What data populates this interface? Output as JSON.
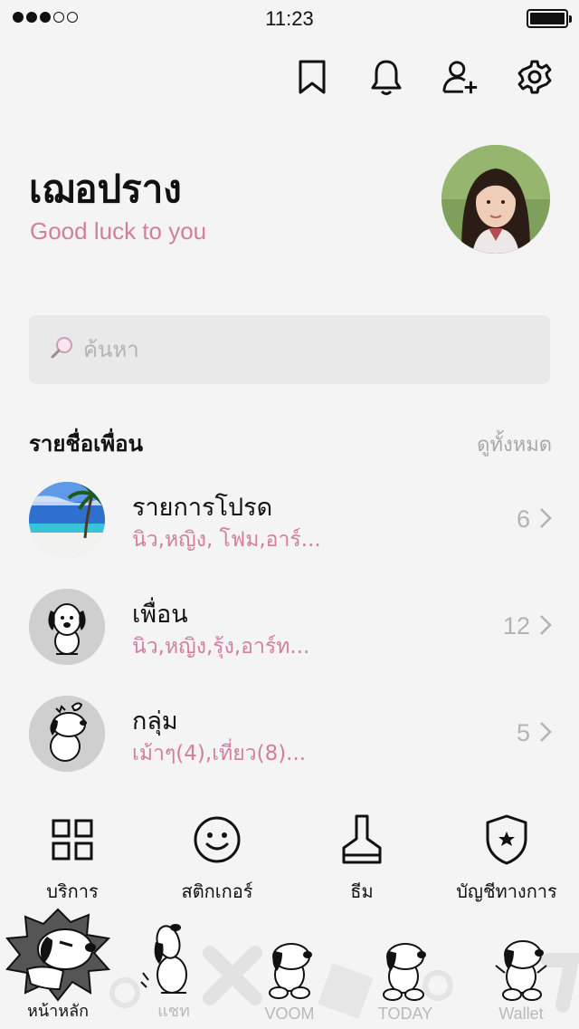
{
  "status_bar": {
    "time": "11:23",
    "signal_bars": 3,
    "signal_total": 5,
    "battery_level": 1.0
  },
  "header": {
    "actions": [
      {
        "name": "bookmark-icon"
      },
      {
        "name": "bell-icon"
      },
      {
        "name": "add-friend-icon"
      },
      {
        "name": "gear-icon"
      }
    ]
  },
  "profile": {
    "name": "เฌอปราง",
    "status_message": "Good luck to you"
  },
  "search": {
    "placeholder": "ค้นหา"
  },
  "friends_section": {
    "title": "รายชื่อเพื่อน",
    "view_all": "ดูทั้งหมด",
    "groups": [
      {
        "title": "รายการโปรด",
        "members": "นิว,หญิง, โฟม,อาร์...",
        "count": "6",
        "thumb": "beach"
      },
      {
        "title": "เพื่อน",
        "members": "นิว,หญิง,รุ้ง,อาร์ท...",
        "count": "12",
        "thumb": "snoopy-sitting"
      },
      {
        "title": "กลุ่ม",
        "members": "เม้าๆ(4),เที่ยว(8)...",
        "count": "5",
        "thumb": "snoopy-woodstock"
      }
    ]
  },
  "shortcuts": [
    {
      "label": "บริการ",
      "icon": "grid-icon"
    },
    {
      "label": "สติกเกอร์",
      "icon": "smiley-icon"
    },
    {
      "label": "ธีม",
      "icon": "brush-icon"
    },
    {
      "label": "บัญชีทางการ",
      "icon": "shield-star-icon"
    }
  ],
  "tabs": [
    {
      "label": "หน้าหลัก",
      "active": true
    },
    {
      "label": "แชท",
      "active": false
    },
    {
      "label": "VOOM",
      "active": false
    },
    {
      "label": "TODAY",
      "active": false
    },
    {
      "label": "Wallet",
      "active": false
    }
  ],
  "colors": {
    "accent_pink": "#d27f9e",
    "background": "#f4f4f4",
    "muted": "#b3b3b3"
  }
}
